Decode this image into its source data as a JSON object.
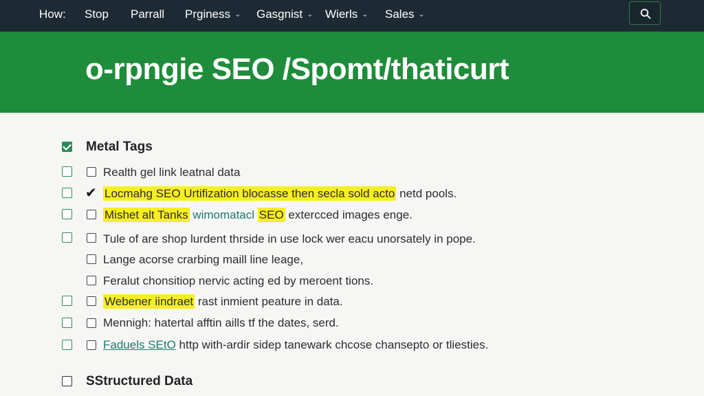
{
  "nav": {
    "items": [
      {
        "label": "How:",
        "has_dropdown": false
      },
      {
        "label": "Stop",
        "has_dropdown": false
      },
      {
        "label": "Parrall",
        "has_dropdown": false
      },
      {
        "label": "Prginess",
        "has_dropdown": true
      },
      {
        "label": "Gasgnist",
        "has_dropdown": true
      },
      {
        "label": "Wierls",
        "has_dropdown": true
      },
      {
        "label": "Sales",
        "has_dropdown": true
      }
    ],
    "search_icon": "search-icon"
  },
  "banner": {
    "title": "o-rpngie SEO /Spomt/thaticurt",
    "color": "#1e8c3a"
  },
  "sections": {
    "meta": {
      "title": "Metal Tags",
      "checked": true
    },
    "structured": {
      "title": "SStructured Data",
      "checked": false
    }
  },
  "items": [
    {
      "text": "Realth gel link leatnal data"
    },
    {
      "highlight": "Locmahg SEO Urtifization blocasse then secla sold acto",
      "rest": " netd pools."
    },
    {
      "highlight": "Mishet alt Tanks",
      "teal_a": " wimomatacl ",
      "highlight2": "SEO",
      "rest": "  extercced images enge."
    },
    {
      "text": "Tule of are shop lurdent thrside in use lock wer eacu unorsately in pope."
    },
    {
      "text": "Lange acorse crarbing maill line leage,"
    },
    {
      "text": "Feralut chonsitiop nervic acting ed by meroent tions."
    },
    {
      "highlight": "Webener iindraet",
      "rest": " rast inmient peature in data."
    },
    {
      "text": "Mennigh: hatertal afftin aills tf the dates, serd."
    },
    {
      "link": "Faduels SEtO",
      "rest": " http with-ardir sidep tanewark chcose chansepto or tliesties."
    }
  ]
}
